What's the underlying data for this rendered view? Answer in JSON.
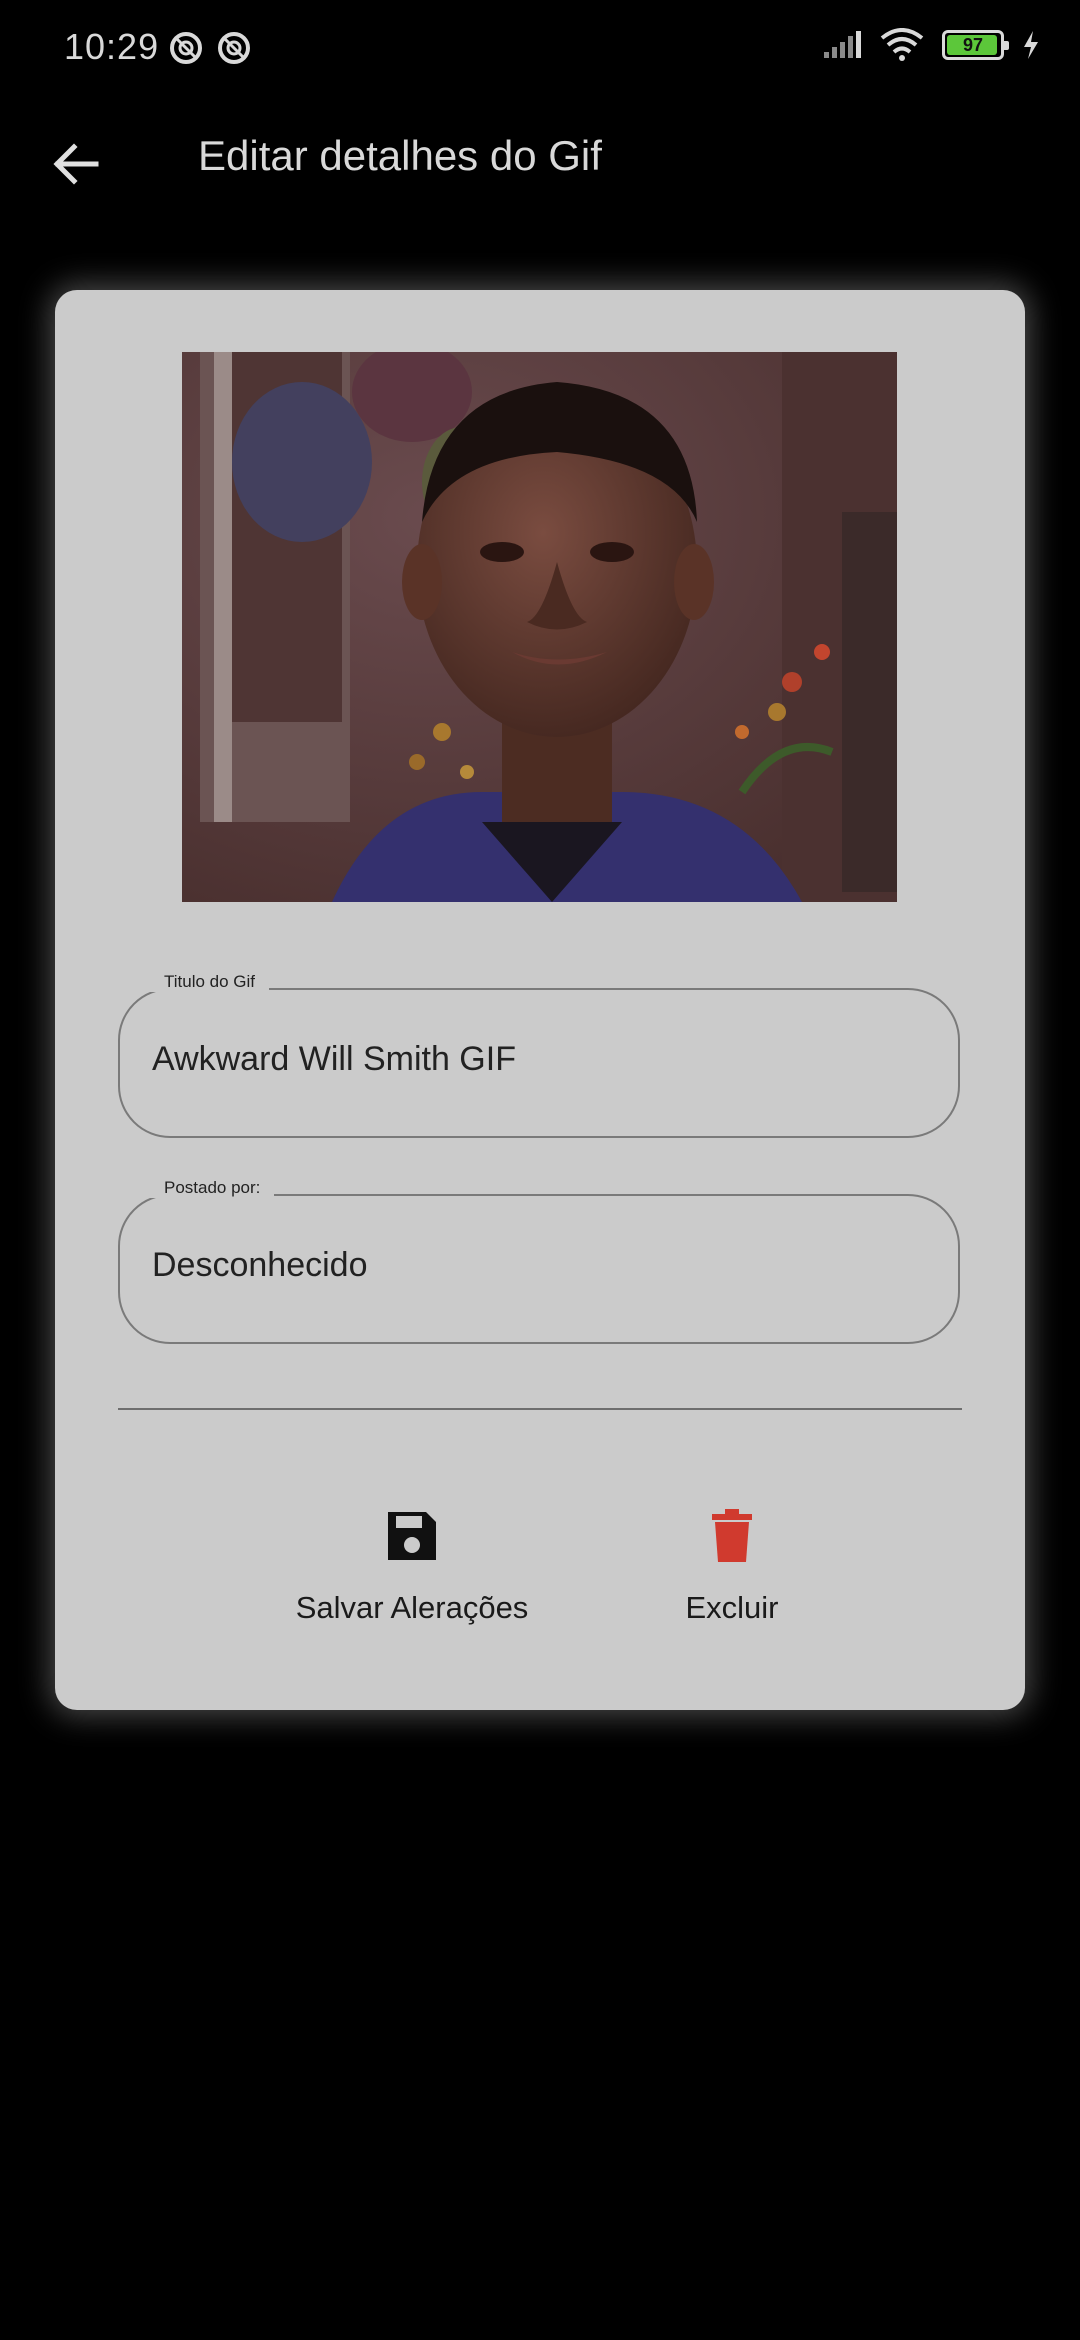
{
  "status_bar": {
    "time": "10:29",
    "battery_level": "97",
    "battery_fraction": 0.97,
    "icons_left": [
      "no-disturb-icon",
      "no-disturb-icon"
    ],
    "icons_right": [
      "signal-icon",
      "wifi-icon",
      "battery-icon",
      "charging-icon"
    ]
  },
  "app_bar": {
    "title": "Editar detalhes do Gif",
    "back_icon": "arrow-back-icon"
  },
  "form": {
    "title_field": {
      "label": "Titulo do Gif",
      "value": "Awkward Will Smith GIF"
    },
    "posted_by_field": {
      "label": "Postado por:",
      "value": "Desconhecido"
    }
  },
  "actions": {
    "save": {
      "label": "Salvar Alerações",
      "icon": "floppy-disk-icon"
    },
    "delete": {
      "label": "Excluir",
      "icon": "trash-icon",
      "color": "#d03a2e"
    }
  },
  "colors": {
    "background": "#000000",
    "card": "#cbcbcb",
    "battery_green": "#5cc73a"
  }
}
